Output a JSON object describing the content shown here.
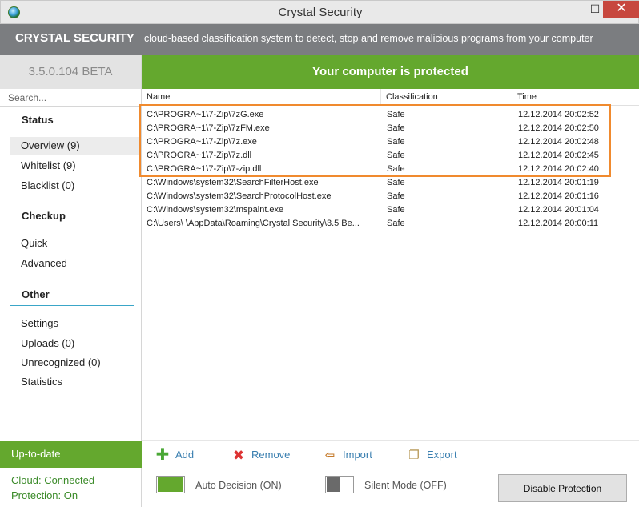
{
  "window": {
    "title": "Crystal Security",
    "minimize": "—",
    "maximize": "☐",
    "close": "✕"
  },
  "header": {
    "brand": "CRYSTAL SECURITY",
    "tagline": "cloud-based classification system to detect, stop and remove malicious programs from your computer"
  },
  "sidebar": {
    "version": "3.5.0.104 BETA",
    "search_placeholder": "Search...",
    "sections": {
      "status": {
        "title": "Status",
        "items": [
          "Overview (9)",
          "Whitelist (9)",
          "Blacklist (0)"
        ]
      },
      "checkup": {
        "title": "Checkup",
        "items": [
          "Quick",
          "Advanced"
        ]
      },
      "other": {
        "title": "Other",
        "items": [
          "Settings",
          "Uploads (0)",
          "Unrecognized (0)",
          "Statistics"
        ]
      }
    },
    "update_status": "Up-to-date",
    "cloud": "Cloud: Connected",
    "protection": "Protection: On"
  },
  "main": {
    "status_banner": "Your computer is protected",
    "columns": [
      "Name",
      "Classification",
      "Time"
    ],
    "rows": [
      {
        "name": "C:\\PROGRA~1\\7-Zip\\7zG.exe",
        "classification": "Safe",
        "time": "12.12.2014 20:02:52"
      },
      {
        "name": "C:\\PROGRA~1\\7-Zip\\7zFM.exe",
        "classification": "Safe",
        "time": "12.12.2014 20:02:50"
      },
      {
        "name": "C:\\PROGRA~1\\7-Zip\\7z.exe",
        "classification": "Safe",
        "time": "12.12.2014 20:02:48"
      },
      {
        "name": "C:\\PROGRA~1\\7-Zip\\7z.dll",
        "classification": "Safe",
        "time": "12.12.2014 20:02:45"
      },
      {
        "name": "C:\\PROGRA~1\\7-Zip\\7-zip.dll",
        "classification": "Safe",
        "time": "12.12.2014 20:02:40"
      },
      {
        "name": "C:\\Windows\\system32\\SearchFilterHost.exe",
        "classification": "Safe",
        "time": "12.12.2014 20:01:19"
      },
      {
        "name": "C:\\Windows\\system32\\SearchProtocolHost.exe",
        "classification": "Safe",
        "time": "12.12.2014 20:01:16"
      },
      {
        "name": "C:\\Windows\\system32\\mspaint.exe",
        "classification": "Safe",
        "time": "12.12.2014 20:01:04"
      },
      {
        "name": "C:\\Users\\          \\AppData\\Roaming\\Crystal Security\\3.5 Be...",
        "classification": "Safe",
        "time": "12.12.2014 20:00:11"
      }
    ]
  },
  "toolbar": {
    "add": "Add",
    "remove": "Remove",
    "import": "Import",
    "export": "Export"
  },
  "bottom": {
    "auto_decision": "Auto Decision (ON)",
    "silent_mode": "Silent Mode (OFF)",
    "disable_button": "Disable Protection"
  },
  "colors": {
    "accent_green": "#64a82e",
    "header_gray": "#7b7d80",
    "highlight_orange": "#f08a2e",
    "link_blue": "#3a7fb0"
  },
  "icons": {
    "add": "plus-icon",
    "remove": "x-icon",
    "import": "import-icon",
    "export": "export-icon"
  }
}
